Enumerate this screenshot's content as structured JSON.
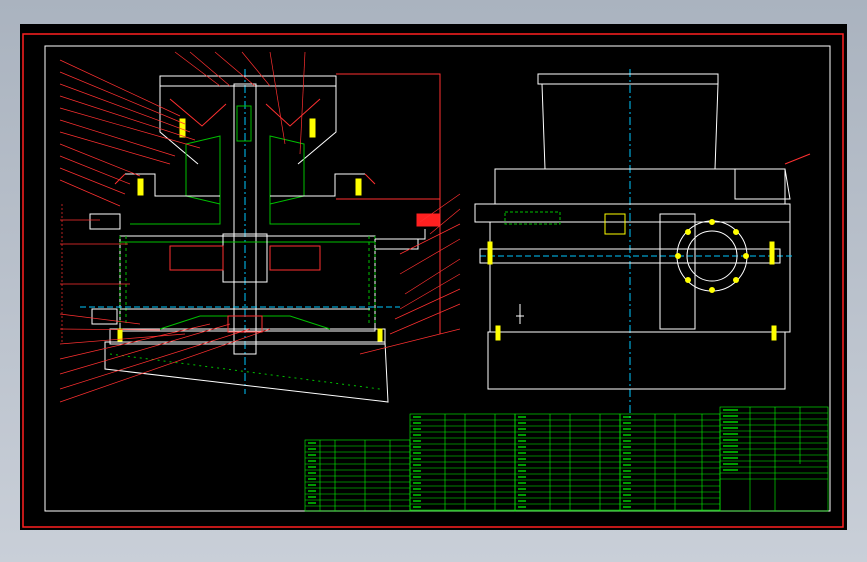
{
  "drawing": {
    "title_block": {
      "name_cell": "",
      "scale_cell": ""
    },
    "colors": {
      "background": "#000000",
      "outer_border": "#ff2020",
      "inner_border": "#ffffff",
      "part_outline": "#ffffff",
      "center_line": "#00c8ff",
      "leader": "#ff3030",
      "hatch": "#00c000",
      "bolt": "#ffff00",
      "table_text": "#00ff00"
    },
    "icons": [
      "bolt-icon",
      "nozzle-icon",
      "valve-icon"
    ]
  }
}
